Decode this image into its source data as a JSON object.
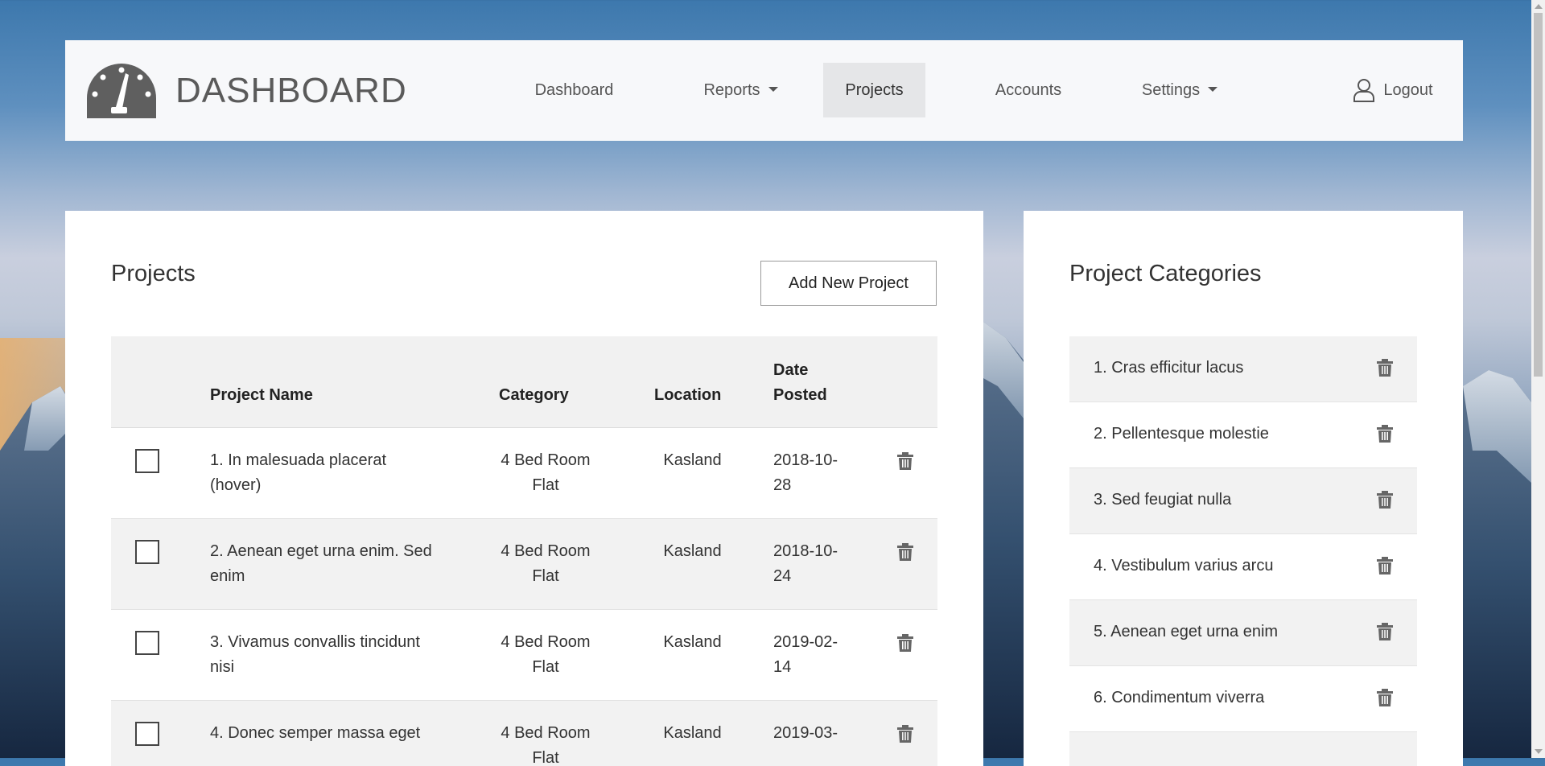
{
  "brand": {
    "title": "DASHBOARD"
  },
  "nav": {
    "items": [
      {
        "label": "Dashboard"
      },
      {
        "label": "Reports"
      },
      {
        "label": "Projects"
      },
      {
        "label": "Accounts"
      },
      {
        "label": "Settings"
      }
    ],
    "logout": "Logout"
  },
  "projects": {
    "title": "Projects",
    "add_button": "Add New Project",
    "headers": {
      "name": "Project Name",
      "category": "Category",
      "location": "Location",
      "date_line1": "Date",
      "date_line2": "Posted"
    },
    "rows": [
      {
        "name1": "1. In malesuada placerat",
        "name2": "(hover)",
        "cat1": "4 Bed Room",
        "cat2": "Flat",
        "location": "Kasland",
        "date1": "2018-10-",
        "date2": "28"
      },
      {
        "name1": "2. Aenean eget urna enim. Sed",
        "name2": "enim",
        "cat1": "4 Bed Room",
        "cat2": "Flat",
        "location": "Kasland",
        "date1": "2018-10-",
        "date2": "24"
      },
      {
        "name1": "3. Vivamus convallis tincidunt",
        "name2": "nisi",
        "cat1": "4 Bed Room",
        "cat2": "Flat",
        "location": "Kasland",
        "date1": "2019-02-",
        "date2": "14"
      },
      {
        "name1": "4. Donec semper massa eget",
        "name2": "",
        "cat1": "4 Bed Room",
        "cat2": "Flat",
        "location": "Kasland",
        "date1": "2019-03-",
        "date2": ""
      }
    ]
  },
  "categories": {
    "title": "Project Categories",
    "items": [
      {
        "label": "1. Cras efficitur lacus"
      },
      {
        "label": "2. Pellentesque molestie"
      },
      {
        "label": "3. Sed feugiat nulla"
      },
      {
        "label": "4. Vestibulum varius arcu"
      },
      {
        "label": "5. Aenean eget urna enim"
      },
      {
        "label": "6. Condimentum viverra"
      },
      {
        "label": ""
      }
    ]
  },
  "icons": {
    "brand": "speedometer-icon",
    "logout": "user-icon",
    "delete": "trash-icon",
    "dropdown": "caret-down-icon"
  },
  "colors": {
    "navbar_bg": "#f7f8fa",
    "active_nav_bg": "#e5e6e8",
    "stripe_bg": "#f2f2f2",
    "icon_gray": "#666666"
  }
}
